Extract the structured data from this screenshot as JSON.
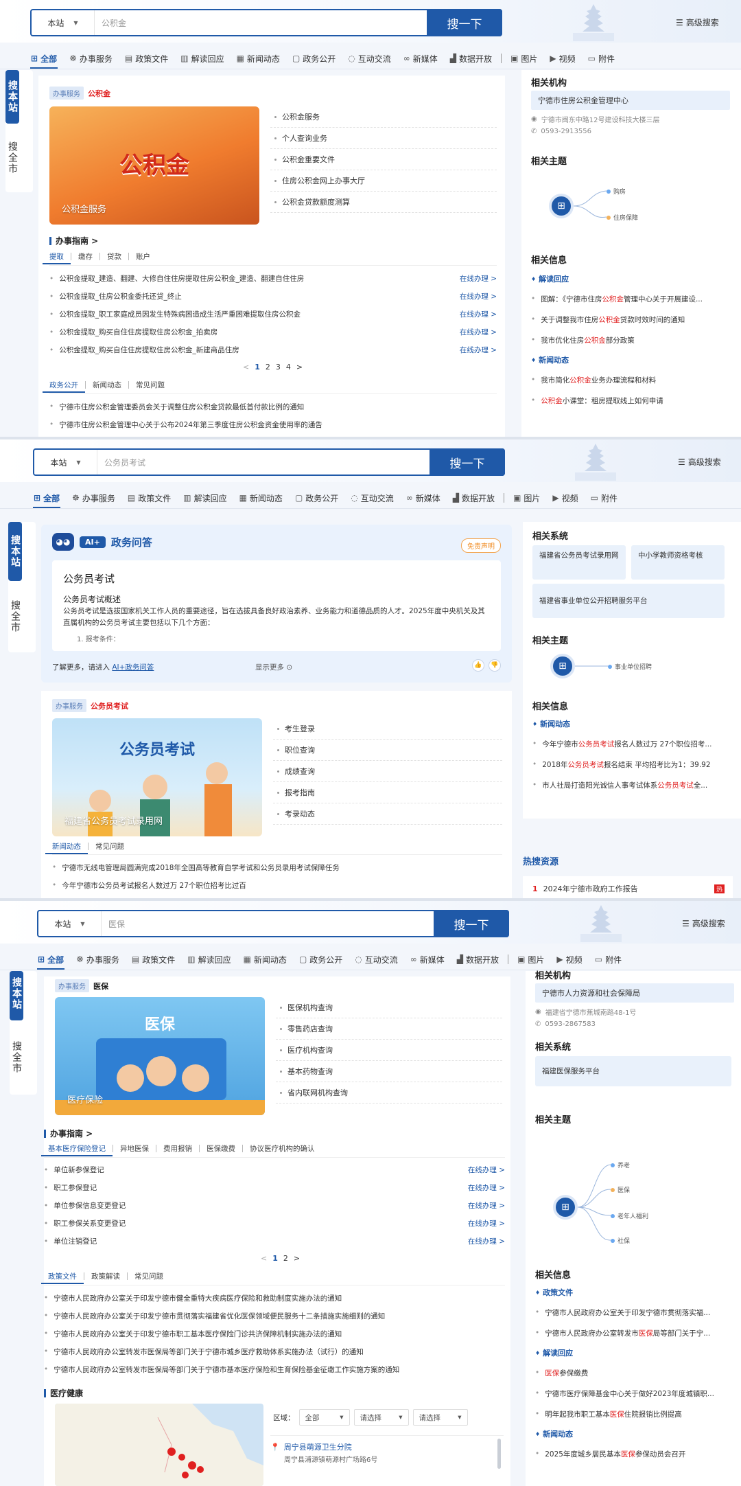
{
  "common": {
    "scope_label": "本站",
    "search_button": "搜一下",
    "advanced_search": "高级搜索",
    "side_this_site": "搜本站",
    "side_city": "搜全市",
    "tabs": [
      "全部",
      "办事服务",
      "政策文件",
      "解读回应",
      "新闻动态",
      "政务公开",
      "互动交流",
      "新媒体",
      "数据开放",
      "图片",
      "视频",
      "附件"
    ]
  },
  "panel1": {
    "query": "公积金",
    "badge": "办事服务",
    "keyword": "公积金",
    "hero_big": "公积金",
    "hero_caption": "公积金服务",
    "services": [
      "公积金服务",
      "个人查询业务",
      "公积金重要文件",
      "住房公积金网上办事大厅",
      "公积金贷款额度测算"
    ],
    "guide_title": "办事指南 >",
    "guide_tabs": [
      "提取",
      "缴存",
      "贷款",
      "账户"
    ],
    "guide_rows": [
      {
        "title": "公积金提取_建造、翻建、大修自住住房提取住房公积金_建造、翻建自住住房",
        "op": "在线办理 >"
      },
      {
        "title": "公积金提取_住房公积金委托还贷_终止",
        "op": "在线办理 >"
      },
      {
        "title": "公积金提取_职工家庭成员因发生特殊病困造成生活严重困难提取住房公积金",
        "op": "在线办理 >"
      },
      {
        "title": "公积金提取_购买自住住房提取住房公积金_拍卖房",
        "op": "在线办理 >"
      },
      {
        "title": "公积金提取_购买自住住房提取住房公积金_新建商品住房",
        "op": "在线办理 >"
      }
    ],
    "pages": [
      "1",
      "2",
      "3",
      "4"
    ],
    "news_tabs": [
      "政务公开",
      "新闻动态",
      "常见问题"
    ],
    "news": [
      "宁德市住房公积金管理委员会关于调整住房公积金贷款最低首付款比例的通知",
      "宁德市住房公积金管理中心关于公布2024年第三季度住房公积金资金使用率的通告"
    ],
    "right": {
      "org_title": "相关机构",
      "org_name": "宁德市住房公积金管理中心",
      "org_addr": "宁德市闽东中路12号建设科技大楼三层",
      "org_phone": "0593-2913556",
      "topic_title": "相关主题",
      "topics": [
        "购房",
        "住房保障"
      ],
      "info_title": "相关信息",
      "sub1": "解读回应",
      "sub1_rows": [
        {
          "pre": "图解：《宁德市住房",
          "hl": "公积金",
          "post": "管理中心关于开展建设..."
        },
        {
          "pre": "关于调整我市住房",
          "hl": "公积金",
          "post": "贷款时效时间的通知"
        },
        {
          "pre": "我市优化住房",
          "hl": "公积金",
          "post": "部分政策"
        }
      ],
      "sub2": "新闻动态",
      "sub2_rows": [
        {
          "pre": "我市简化",
          "hl": "公积金",
          "post": "业务办理流程和材料"
        },
        {
          "pre": "",
          "hl": "公积金",
          "post": "小课堂：租房提取线上如何申请"
        }
      ]
    }
  },
  "panel2": {
    "query": "公务员考试",
    "ai_title": "政务问答",
    "ai_badge": "AI+",
    "disclaimer": "免责声明",
    "ai_heading": "公务员考试",
    "ai_sub": "公务员考试概述",
    "ai_text": "公务员考试是选拔国家机关工作人员的重要途径，旨在选拔具备良好政治素养、业务能力和道德品质的人才。2025年度中央机关及其直属机构的公务员考试主要包括以下几个方面：",
    "ai_item": "1. 报考条件：",
    "ai_more_pre": "了解更多，请进入",
    "ai_more_link": "AI+政务问答",
    "show_more": "显示更多",
    "badge": "办事服务",
    "keyword": "公务员考试",
    "hero_big": "公务员考试",
    "hero_caption": "福建省公务员考试录用网",
    "services": [
      "考生登录",
      "职位查询",
      "成绩查询",
      "报考指南",
      "考录动态"
    ],
    "news_tabs": [
      "新闻动态",
      "常见问题"
    ],
    "news": [
      "宁德市无线电管理局圆满完成2018年全国高等教育自学考试和公务员录用考试保障任务",
      "今年宁德市公务员考试报名人数过万 27个职位招考比过百"
    ],
    "right": {
      "sys_title": "相关系统",
      "systems": [
        "福建省公务员考试录用网",
        "中小学教师资格考核",
        "福建省事业单位公开招聘服务平台"
      ],
      "topic_title": "相关主题",
      "topics": [
        "事业单位招聘"
      ],
      "info_title": "相关信息",
      "sub1": "新闻动态",
      "rows": [
        {
          "pre": "今年宁德市",
          "hl": "公务员考试",
          "post": "报名人数过万 27个职位招考..."
        },
        {
          "pre": "2018年",
          "hl": "公务员考试",
          "post": "报名结束 平均招考比为1：39.92"
        },
        {
          "pre": "市人社局打造阳光诚信人事考试体系 ",
          "hl": "公务员考试",
          "post": "全..."
        }
      ],
      "hot_title": "热搜资源",
      "hot_num": "1",
      "hot_text": "2024年宁德市政府工作报告",
      "hot_tag": "热"
    }
  },
  "panel3": {
    "query": "医保",
    "badge": "办事服务",
    "keyword": "医保",
    "hero_big": "医保",
    "hero_caption": "医疗保险",
    "services": [
      "医保机构查询",
      "零售药店查询",
      "医疗机构查询",
      "基本药物查询",
      "省内联网机构查询"
    ],
    "guide_title": "办事指南 >",
    "guide_tabs": [
      "基本医疗保险登记",
      "异地医保",
      "费用报销",
      "医保缴费",
      "协议医疗机构的确认"
    ],
    "guide_rows": [
      {
        "title": "单位新参保登记",
        "op": "在线办理 >"
      },
      {
        "title": "职工参保登记",
        "op": "在线办理 >"
      },
      {
        "title": "单位参保信息变更登记",
        "op": "在线办理 >"
      },
      {
        "title": "职工参保关系变更登记",
        "op": "在线办理 >"
      },
      {
        "title": "单位注销登记",
        "op": "在线办理 >"
      }
    ],
    "pages": [
      "1",
      "2"
    ],
    "news_tabs": [
      "政策文件",
      "政策解读",
      "常见问题"
    ],
    "news": [
      "宁德市人民政府办公室关于印发宁德市健全重特大疾病医疗保险和救助制度实施办法的通知",
      "宁德市人民政府办公室关于印发宁德市贯彻落实福建省优化医保领域便民服务十二条措施实施细则的通知",
      "宁德市人民政府办公室关于印发宁德市职工基本医疗保险门诊共济保障机制实施办法的通知",
      "宁德市人民政府办公室转发市医保局等部门关于宁德市城乡医疗救助体系实施办法（试行）的通知",
      "宁德市人民政府办公室转发市医保局等部门关于宁德市基本医疗保险和生育保险基金征缴工作实施方案的通知"
    ],
    "health_title": "医疗健康",
    "region_label": "区域：",
    "region_sel": [
      "全部",
      "请选择",
      "请选择"
    ],
    "hospital_name": "周宁县萌源卫生分院",
    "hospital_addr": "周宁县浦源镇萌源村广场路6号",
    "right": {
      "org_title": "相关机构",
      "org_name": "宁德市人力资源和社会保障局",
      "org_addr": "福建省宁德市蕉城南路48-1号",
      "org_phone": "0593-2867583",
      "sys_title": "相关系统",
      "systems": [
        "福建医保服务平台"
      ],
      "topic_title": "相关主题",
      "topics": [
        "养老",
        "医保",
        "老年人福利",
        "社保"
      ],
      "info_title": "相关信息",
      "sub1": "政策文件",
      "sub1_rows": [
        {
          "pre": "宁德市人民政府办公室关于印发宁德市贯彻落实福...",
          "hl": "",
          "post": ""
        },
        {
          "pre": "宁德市人民政府办公室转发市",
          "hl": "医保",
          "post": "局等部门关于宁..."
        }
      ],
      "sub2": "解读回应",
      "sub2_rows": [
        {
          "pre": "",
          "hl": "医保",
          "post": "参保缴费"
        },
        {
          "pre": "宁德市医疗保障基金中心关于做好2023年度城镇职...",
          "hl": "",
          "post": ""
        },
        {
          "pre": "明年起我市职工基本",
          "hl": "医保",
          "post": "住院报销比例提高"
        }
      ],
      "sub3": "新闻动态",
      "sub3_rows": [
        {
          "pre": "2025年度城乡居民基本",
          "hl": "医保",
          "post": "参保动员会召开"
        }
      ]
    }
  }
}
